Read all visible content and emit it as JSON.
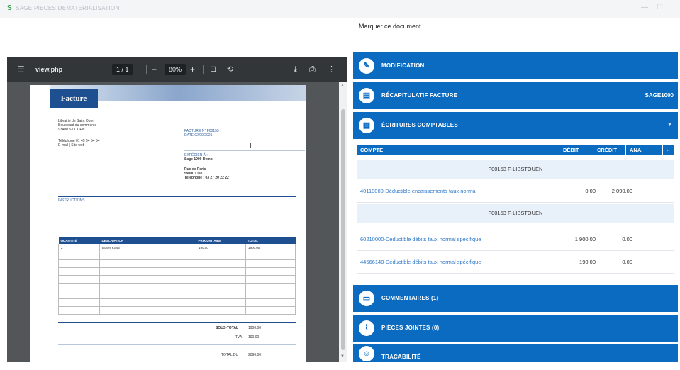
{
  "window": {
    "title": "SAGE PIECES DEMATERIALISATION",
    "app_icon": "S"
  },
  "mark_document": {
    "label": "Marquer ce document"
  },
  "pdf_viewer": {
    "filename": "view.php",
    "page_indicator": "1 / 1",
    "zoom": "80%",
    "invoice": {
      "title": "Facture",
      "seller": [
        "Librairie de Saint Ouen",
        "Boulevard du commerce",
        "93400 ST OUEN",
        "",
        "Téléphone 01 45 54 54 54 |",
        "E-mail | Site web"
      ],
      "invoice_no": "FACTURE N° F00153",
      "invoice_date": "DATE 02/09/2021",
      "ship_to_label": "EXPÉDIER À :",
      "ship_to": [
        "Sage 1000 Demo",
        "",
        "Rue de Paris",
        "59000 Lille",
        "Téléphone : 03 27 20 22 22"
      ],
      "instructions_label": "INSTRUCTIONS",
      "table_headers": [
        "QUANTITÉ",
        "DESCRIPTION",
        "PRIX UNITAIRE",
        "TOTAL"
      ],
      "table_rows": [
        [
          "2",
          "Boites KS45",
          "190.00",
          "1900.00"
        ]
      ],
      "totals": [
        {
          "label": "SOUS-TOTAL",
          "value": "1900.00"
        },
        {
          "label": "TVA",
          "value": "190.00"
        },
        {
          "label": "TOTAL DU",
          "value": "2090.00"
        }
      ]
    }
  },
  "panels": {
    "modification": {
      "label": "MODIFICATION",
      "icon": "pencil-icon"
    },
    "recap": {
      "label": "RÉCAPITULATIF FACTURE",
      "right": "SAGE1000",
      "icon": "invoice-icon"
    },
    "ecritures": {
      "label": "ÉCRITURES COMPTABLES",
      "icon": "ledger-icon"
    },
    "commentaires": {
      "label": "COMMENTAIRES (1)",
      "icon": "comment-icon"
    },
    "pieces": {
      "label": "PIÈCES JOINTES (0)",
      "icon": "paperclip-icon"
    },
    "tracabilite": {
      "label": "TRACABILITÉ",
      "icon": "people-icon"
    }
  },
  "entries": {
    "headers": {
      "compte": "COMPTE",
      "debit": "DÉBIT",
      "credit": "CRÉDIT",
      "ana": "ANA."
    },
    "groups": [
      {
        "label": "F00153 F-LIBSTOUEN",
        "rows": [
          {
            "account": "40110000-Déductible encaissements taux normal",
            "debit": "0.00",
            "credit": "2 090.00"
          }
        ]
      },
      {
        "label": "F00153 F-LIBSTOUEN",
        "rows": [
          {
            "account": "60210000-Déductible débits taux normal spécifique",
            "debit": "1 900.00",
            "credit": "0.00"
          },
          {
            "account": "44566140-Déductible débits taux normal spécifique",
            "debit": "190.00",
            "credit": "0.00"
          }
        ]
      }
    ]
  },
  "colors": {
    "accent": "#0a6bc1",
    "pdf_toolbar": "#323639",
    "invoice_blue": "#1d4f91"
  }
}
